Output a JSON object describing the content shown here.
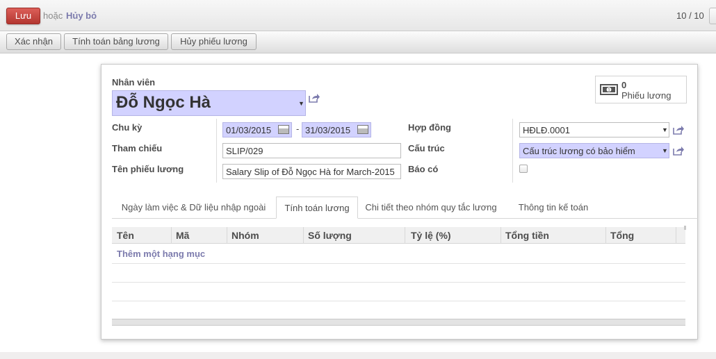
{
  "header": {
    "save_label": "Lưu",
    "or_text": "hoặc",
    "discard_label": "Hủy bỏ",
    "pager": "10 / 10"
  },
  "statusbar": {
    "buttons": [
      "Xác nhận",
      "Tính toán bảng lương",
      "Hủy phiếu lương"
    ]
  },
  "form": {
    "employee_label": "Nhân viên",
    "employee_value": "Đỗ Ngọc Hà",
    "smart_button": {
      "count": "0",
      "label": "Phiếu lương",
      "icon": "money-icon"
    },
    "period_label": "Chu kỳ",
    "date_from": "01/03/2015",
    "date_to": "31/03/2015",
    "date_dash": "-",
    "reference_label": "Tham chiếu",
    "reference_value": "SLIP/029",
    "payslip_name_label": "Tên phiếu lương",
    "payslip_name_value": "Salary Slip of Đỗ Ngọc Hà for March-2015",
    "contract_label": "Hợp đồng",
    "contract_value": "HĐLĐ.0001",
    "structure_label": "Cấu trúc",
    "structure_value": "Cấu trúc lương có bảo hiểm",
    "credit_note_label": "Báo có",
    "credit_note_checked": false
  },
  "tabs": [
    {
      "label": "Ngày làm việc & Dữ liệu nhập ngoài",
      "active": false
    },
    {
      "label": "Tính toán lương",
      "active": true
    },
    {
      "label": "Chi tiết theo nhóm quy tắc lương",
      "active": false
    },
    {
      "label": "Thông tin kế toán",
      "active": false
    }
  ],
  "table": {
    "columns": [
      "Tên",
      "Mã",
      "Nhóm",
      "Số lượng",
      "Tỷ lệ (%)",
      "Tổng tiền",
      "Tổng"
    ],
    "add_line": "Thêm một hạng mục"
  },
  "colors": {
    "save_button": "#c9443d",
    "required_field": "#d2d2ff",
    "link": "#7c7bad"
  }
}
